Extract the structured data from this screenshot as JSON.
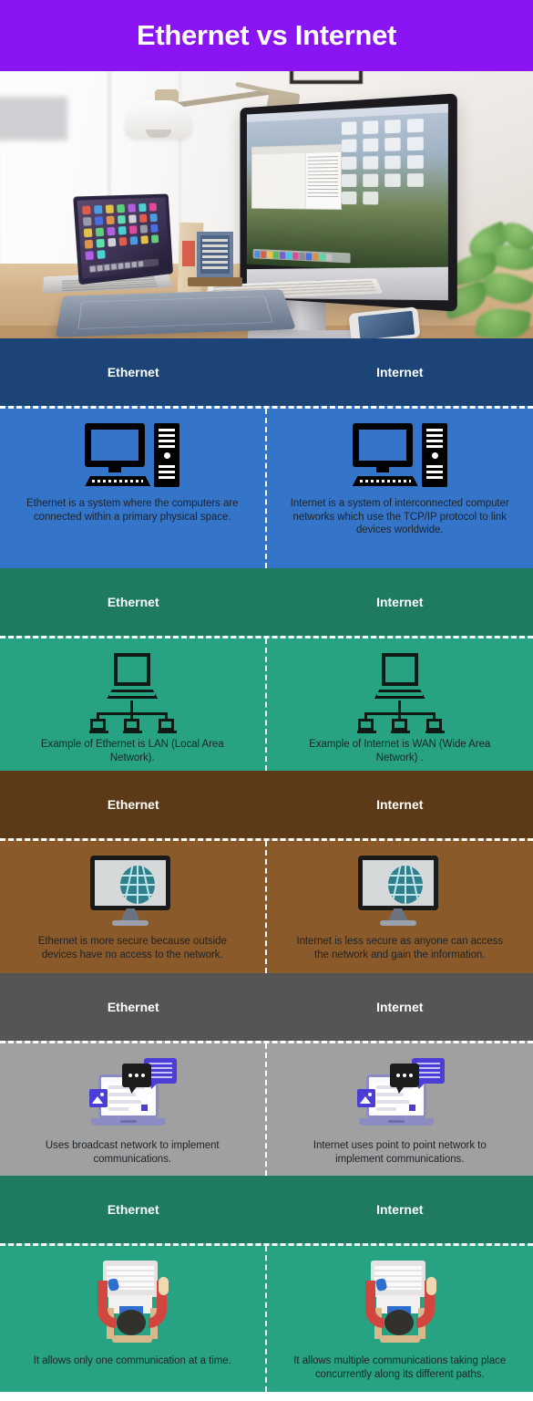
{
  "title": "Ethernet vs Internet",
  "colors": {
    "title_banner": "#8B14F5",
    "section1_header": "#1C4477",
    "section1_body": "#3575C9",
    "section2_header": "#1E7A60",
    "section2_body": "#27A383",
    "section3_header": "#5C3A18",
    "section3_body": "#8B5A2B",
    "section4_header": "#555555",
    "section4_body": "#A0A0A0",
    "section5_header": "#1E7A60",
    "section5_body": "#27A383",
    "divider": "#FFFFFF",
    "body_text": "#1D2329",
    "header_text": "#FFFFFF"
  },
  "hero": {
    "name": "desk-workspace-photo",
    "alt": "Desk workspace with iMac desktop computer, laptop, graphics tablet, keyboard, desk lamp, smartphone and plant"
  },
  "sections": [
    {
      "id": "section-definition",
      "left_header": "Ethernet",
      "right_header": "Internet",
      "left_icon": "desktop-computer-icon",
      "right_icon": "desktop-computer-icon",
      "left_text": "Ethernet is a system where the computers are connected within a primary physical space.",
      "right_text": "Internet is a system of interconnected computer networks which use the TCP/IP protocol to link devices worldwide."
    },
    {
      "id": "section-example",
      "left_header": "Ethernet",
      "right_header": "Internet",
      "left_icon": "network-topology-icon",
      "right_icon": "network-topology-icon",
      "left_text": "Example of Ethernet is LAN (Local Area Network).",
      "right_text": "Example of Internet is WAN (Wide Area Network) ."
    },
    {
      "id": "section-security",
      "left_header": "Ethernet",
      "right_header": "Internet",
      "left_icon": "monitor-globe-icon",
      "right_icon": "monitor-globe-icon",
      "left_text": "Ethernet is more secure because outside devices have no access to the network.",
      "right_text": "Internet is less secure as anyone can access the network and gain the information."
    },
    {
      "id": "section-communication-method",
      "left_header": "Ethernet",
      "right_header": "Internet",
      "left_icon": "laptop-chat-icon",
      "right_icon": "laptop-chat-icon",
      "left_text": "Uses broadcast network to implement communications.",
      "right_text": "Internet uses point to point network to implement communications."
    },
    {
      "id": "section-concurrency",
      "left_header": "Ethernet",
      "right_header": "Internet",
      "left_icon": "person-at-laptop-icon",
      "right_icon": "person-at-laptop-icon",
      "left_text": "It allows only one communication at a time.",
      "right_text": "It allows multiple communications taking place concurrently along its different paths."
    }
  ]
}
